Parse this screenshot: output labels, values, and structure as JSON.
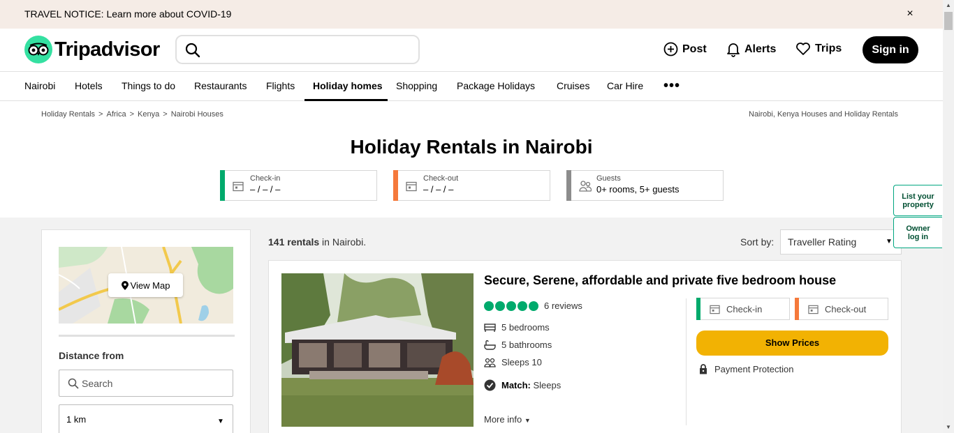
{
  "notice": {
    "text": "TRAVEL NOTICE: Learn more about COVID-19",
    "close": "×"
  },
  "header": {
    "logo_text": "Tripadvisor",
    "search_placeholder": "",
    "post": "Post",
    "alerts": "Alerts",
    "trips": "Trips",
    "sign_in": "Sign in"
  },
  "nav": {
    "items": [
      "Nairobi",
      "Hotels",
      "Things to do",
      "Restaurants",
      "Flights",
      "Holiday homes",
      "Shopping",
      "Package Holidays",
      "Cruises",
      "Car Hire"
    ],
    "active": "Holiday homes",
    "more": "•••"
  },
  "breadcrumbs": {
    "items": [
      "Holiday Rentals",
      "Africa",
      "Kenya",
      "Nairobi Houses"
    ],
    "right": "Nairobi, Kenya Houses and Holiday Rentals"
  },
  "page_title": "Holiday Rentals in Nairobi",
  "dates": {
    "checkin_label": "Check-in",
    "checkin_value": "– / – / –",
    "checkout_label": "Check-out",
    "checkout_value": "– / – / –",
    "guests_label": "Guests",
    "guests_value": "0+ rooms, 5+ guests"
  },
  "side_buttons": {
    "list_property": [
      "List your",
      "property"
    ],
    "owner_login": [
      "Owner",
      "log in"
    ]
  },
  "filters": {
    "view_map": "View Map",
    "distance_title": "Distance from",
    "distance_search_placeholder": "Search",
    "distance_value": "1 km"
  },
  "results": {
    "count": "141 rentals",
    "count_suffix": " in Nairobi.",
    "sort_label": "Sort by:",
    "sort_value": "Traveller Rating"
  },
  "listing": {
    "title": "Secure, Serene, affordable and private five bedroom house",
    "rating_bubbles": 5,
    "reviews": "6 reviews",
    "bedrooms": "5 bedrooms",
    "bathrooms": "5 bathrooms",
    "sleeps": "Sleeps 10",
    "match_label": "Match:",
    "match_value": " Sleeps",
    "more_info": "More info",
    "checkin": "Check-in",
    "checkout": "Check-out",
    "show_prices": "Show Prices",
    "payment": "Payment Protection"
  },
  "colors": {
    "green_accent": "#00aa6c",
    "orange_accent": "#f5793b",
    "grey_accent": "#8c8c8c",
    "yellow_button": "#f2b203",
    "logo_green": "#34e0a1"
  }
}
